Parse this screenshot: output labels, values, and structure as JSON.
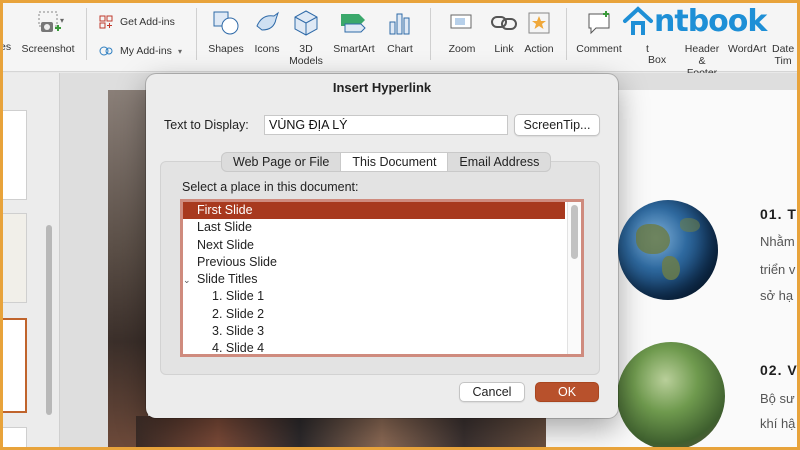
{
  "ribbon": {
    "screenshot_partial": "es",
    "screenshot_label": "Screenshot",
    "get_addins": "Get Add-ins",
    "my_addins": "My Add-ins",
    "shapes": "Shapes",
    "icons": "Icons",
    "models_3d_line1": "3D",
    "models_3d_line2": "Models",
    "smartart": "SmartArt",
    "chart": "Chart",
    "zoom": "Zoom",
    "link": "Link",
    "action": "Action",
    "comment": "Comment",
    "text_box_partial": "t",
    "box": "Box",
    "header_footer_line1": "Header &",
    "header_footer_line2": "Footer",
    "wordart": "WordArt",
    "date_partial_line1": "Date",
    "date_partial_line2": "Tim"
  },
  "brand": {
    "text": "ntbook"
  },
  "slide": {
    "heading1": "01. T",
    "text1a": "Nhằm",
    "text1b": "triển v",
    "text1c": "sở hạ ",
    "heading2": "02. V",
    "text2a": "Bộ sư",
    "text2b": "khí hậ"
  },
  "dialog": {
    "title": "Insert Hyperlink",
    "text_to_display_label": "Text to Display:",
    "text_to_display_value": "VÙNG ĐỊA LÝ",
    "screentip_button": "ScreenTip...",
    "tabs": [
      "Web Page or File",
      "This Document",
      "Email Address"
    ],
    "active_tab": "This Document",
    "select_place_label": "Select a place in this document:",
    "places": [
      "First Slide",
      "Last Slide",
      "Next Slide",
      "Previous Slide",
      "Slide Titles",
      "1. Slide 1",
      "2. Slide 2",
      "3. Slide 3",
      "4. Slide 4"
    ],
    "selected_place": "First Slide",
    "cancel_button": "Cancel",
    "ok_button": "OK"
  },
  "colors": {
    "accent": "#b8512c",
    "selection": "#a8391e",
    "brand": "#1e8fd6",
    "frame": "#e8a33b"
  }
}
